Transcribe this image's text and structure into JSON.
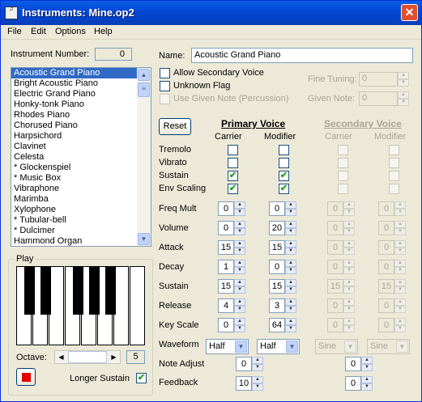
{
  "window": {
    "title": "Instruments: Mine.op2",
    "app_icon": "instrument-icon",
    "close": "✕"
  },
  "menu": [
    "File",
    "Edit",
    "Options",
    "Help"
  ],
  "instrument_number": {
    "label": "Instrument Number:",
    "value": "0"
  },
  "instruments": [
    "Acoustic Grand Piano",
    "Bright Acoustic Piano",
    "Electric Grand Piano",
    "Honky-tonk Piano",
    "Rhodes Piano",
    "Chorused Piano",
    "Harpsichord",
    "Clavinet",
    "Celesta",
    "* Glockenspiel",
    "* Music Box",
    "Vibraphone",
    "Marimba",
    "Xylophone",
    "* Tubular-bell",
    "* Dulcimer",
    "Hammond Organ"
  ],
  "name": {
    "label": "Name:",
    "value": "Acoustic Grand Piano"
  },
  "options": {
    "allow_secondary": "Allow Secondary Voice",
    "unknown_flag": "Unknown Flag",
    "use_given_note": "Use Given Note (Percussion)"
  },
  "fine_tuning": {
    "label": "Fine Tuning:",
    "value": "0"
  },
  "given_note": {
    "label": "Given Note:",
    "value": "0"
  },
  "reset": "Reset",
  "primary": {
    "title": "Primary Voice",
    "carrier": "Carrier",
    "modifier": "Modifier"
  },
  "secondary": {
    "title": "Secondary Voice",
    "carrier": "Carrier",
    "modifier": "Modifier"
  },
  "flags": [
    "Tremolo",
    "Vibrato",
    "Sustain",
    "Env Scaling"
  ],
  "check": "✔",
  "params": [
    {
      "label": "Freq Mult",
      "carrier": "0",
      "modifier": "0"
    },
    {
      "label": "Volume",
      "carrier": "0",
      "modifier": "20"
    },
    {
      "label": "Attack",
      "carrier": "15",
      "modifier": "15"
    },
    {
      "label": "Decay",
      "carrier": "1",
      "modifier": "0"
    },
    {
      "label": "Sustain",
      "carrier": "15",
      "modifier": "15"
    },
    {
      "label": "Release",
      "carrier": "4",
      "modifier": "3"
    },
    {
      "label": "Key Scale",
      "carrier": "0",
      "modifier": "64"
    }
  ],
  "secondary_params": [
    {
      "carrier": "0",
      "modifier": "0"
    },
    {
      "carrier": "0",
      "modifier": "0"
    },
    {
      "carrier": "0",
      "modifier": "0"
    },
    {
      "carrier": "0",
      "modifier": "0"
    },
    {
      "carrier": "15",
      "modifier": "15"
    },
    {
      "carrier": "0",
      "modifier": "0"
    },
    {
      "carrier": "0",
      "modifier": "0"
    }
  ],
  "waveform": {
    "label": "Waveform",
    "primary_carrier": "Half",
    "primary_modifier": "Half",
    "secondary_carrier": "Sine",
    "secondary_modifier": "Sine"
  },
  "note_adjust": {
    "label": "Note Adjust",
    "primary": "0",
    "secondary": "0"
  },
  "feedback": {
    "label": "Feedback",
    "primary": "10",
    "secondary": "0"
  },
  "play": {
    "label": "Play",
    "octave_label": "Octave:",
    "octave": "5",
    "longer_sustain": "Longer Sustain"
  },
  "colors": {
    "stop": "#e00000",
    "selection": "#316ac5"
  }
}
